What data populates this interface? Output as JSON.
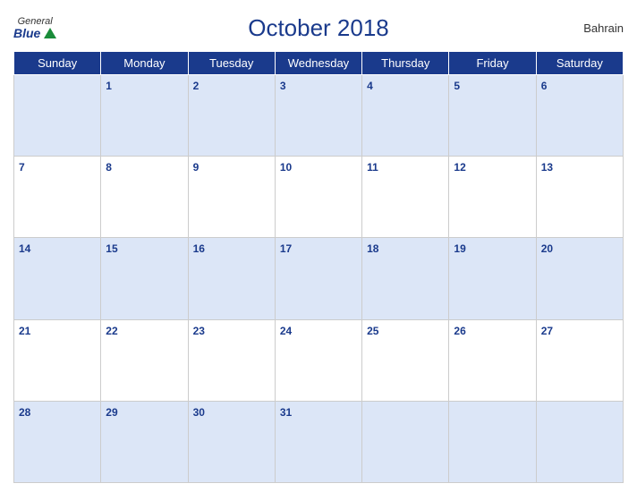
{
  "header": {
    "logo_general": "General",
    "logo_blue": "Blue",
    "title": "October 2018",
    "country": "Bahrain"
  },
  "days_of_week": [
    "Sunday",
    "Monday",
    "Tuesday",
    "Wednesday",
    "Thursday",
    "Friday",
    "Saturday"
  ],
  "weeks": [
    [
      null,
      1,
      2,
      3,
      4,
      5,
      6
    ],
    [
      7,
      8,
      9,
      10,
      11,
      12,
      13
    ],
    [
      14,
      15,
      16,
      17,
      18,
      19,
      20
    ],
    [
      21,
      22,
      23,
      24,
      25,
      26,
      27
    ],
    [
      28,
      29,
      30,
      31,
      null,
      null,
      null
    ]
  ]
}
